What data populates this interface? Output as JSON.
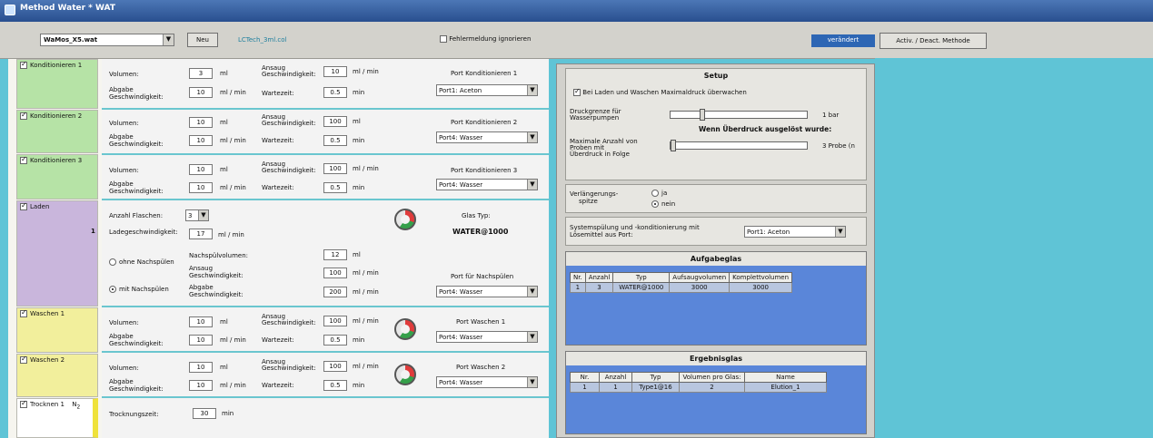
{
  "window": {
    "title": "Method Water * WAT"
  },
  "toolbar": {
    "method_file": "WaMos_X5.wat",
    "new_button": "Neu",
    "link_file": "LCTech_3ml.col",
    "ignore_errors_label": "Fehlermeldung ignorieren",
    "status_label": "verändert",
    "activate_button": "Activ. / Deact. Methode"
  },
  "steps": [
    {
      "label": "Konditionieren 1",
      "color": "#b6e3a6"
    },
    {
      "label": "Konditionieren 2",
      "color": "#b6e3a6"
    },
    {
      "label": "Konditionieren 3",
      "color": "#b6e3a6"
    },
    {
      "label": "Laden",
      "color": "#c9b6dc"
    },
    {
      "label": "Waschen 1",
      "color": "#f2ef9c"
    },
    {
      "label": "Waschen 2",
      "color": "#f2ef9c"
    },
    {
      "label": "Trocknen 1",
      "color": "#ffffff"
    }
  ],
  "labels": {
    "volumen": "Volumen:",
    "abgabe": "Abgabe",
    "abgabe2": "Geschwindigkeit:",
    "ansaug": "Ansaug",
    "ansaug2": "Geschwindigkeit:",
    "wartezeit": "Wartezeit:",
    "unit_ml": "ml",
    "unit_mlmin": "ml / min",
    "unit_min": "min"
  },
  "cond1": {
    "vol": "3",
    "abgabe": "10",
    "ansaug": "10",
    "wartezeit": "0.5",
    "port_label": "Port Konditionieren 1",
    "port": "Port1: Aceton"
  },
  "cond2": {
    "vol": "10",
    "abgabe": "10",
    "ansaug": "100",
    "wartezeit": "0.5",
    "port_label": "Port Konditionieren 2",
    "port": "Port4: Wasser"
  },
  "cond3": {
    "vol": "10",
    "abgabe": "10",
    "ansaug": "100",
    "wartezeit": "0.5",
    "port_label": "Port Konditionieren 3",
    "port": "Port4: Wasser"
  },
  "laden": {
    "side_num": "1",
    "anzahl_label": "Anzahl Flaschen:",
    "anzahl": "3",
    "ladegeschw_label": "Ladegeschwindigkeit:",
    "ladegeschw": "17",
    "glas_typ_label": "Glas Typ:",
    "glas_typ": "WATER@1000",
    "ohne": "ohne Nachspülen",
    "mit": "mit Nachspülen",
    "nachspuel_label": "Nachspülvolumen:",
    "nachspuel": "12",
    "ansaug_val": "100",
    "abgabe_val": "200",
    "port_label": "Port für Nachspülen",
    "port": "Port4: Wasser"
  },
  "wasch1": {
    "vol": "10",
    "abgabe": "10",
    "ansaug": "100",
    "wartezeit": "0.5",
    "port_label": "Port Waschen 1",
    "port": "Port4: Wasser"
  },
  "wasch2": {
    "vol": "10",
    "abgabe": "10",
    "ansaug": "100",
    "wartezeit": "0.5",
    "port_label": "Port Waschen 2",
    "port": "Port4: Wasser"
  },
  "trocknen": {
    "sub": "N",
    "sub2": "2",
    "label": "Trocknungszeit:",
    "val": "30",
    "unit": "min"
  },
  "setup": {
    "title": "Setup",
    "max_pressure_label": "Bei Laden und Waschen Maximaldruck überwachen",
    "druck_label1": "Druckgrenze für",
    "druck_label2": "Wasserpumpen",
    "druck_value": "1 bar",
    "overpressure_title": "Wenn Überdruck ausgelöst wurde:",
    "max_proben1": "Maximale Anzahl von",
    "max_proben2": "Proben mit",
    "max_proben3": "Überdruck in Folge",
    "proben_value": "3 Probe (n",
    "spitze1": "Verlängerungs-",
    "spitze2": "spitze",
    "ja": "ja",
    "nein": "nein",
    "spuel1": "Systemspülung und -konditionierung mit",
    "spuel2": "Lösemittel aus Port:",
    "spuel_port": "Port1: Aceton"
  },
  "aufgabeglas": {
    "title": "Aufgabeglas",
    "headers": [
      "Nr.",
      "Anzahl",
      "Typ",
      "Aufsaugvolumen",
      "Komplettvolumen"
    ],
    "rows": [
      [
        "1",
        "3",
        "WATER@1000",
        "3000",
        "3000"
      ]
    ]
  },
  "ergebnisglas": {
    "title": "Ergebnisglas",
    "headers": [
      "Nr.",
      "Anzahl",
      "Typ",
      "Volumen pro Glas:",
      "Name"
    ],
    "rows": [
      [
        "1",
        "1",
        "Type1@16",
        "2",
        "Elution_1"
      ]
    ]
  }
}
